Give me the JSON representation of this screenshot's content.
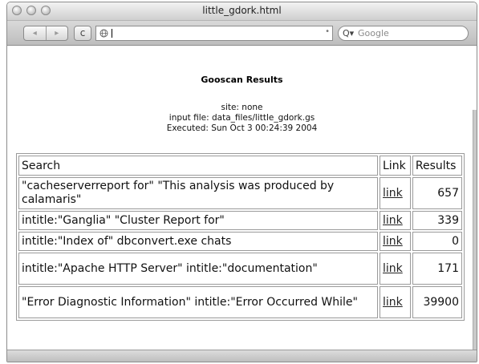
{
  "window": {
    "title": "little_gdork.html"
  },
  "toolbar": {
    "back_icon": "◂",
    "forward_icon": "▸",
    "reload_icon": "c",
    "url_value": "",
    "stop_icon": "•",
    "search_placeholder": "Google",
    "search_icon": "Q▾"
  },
  "page": {
    "title": "Gooscan Results",
    "site_line": "site: none",
    "input_line": "input file: data_files/little_gdork.gs",
    "executed_line": "Executed: Sun Oct 3 00:24:39 2004"
  },
  "table": {
    "headers": [
      "Search",
      "Link",
      "Results"
    ],
    "rows": [
      {
        "search": "\"cacheserverreport for\" \"This analysis was produced by calamaris\"",
        "link": "link",
        "results": "657"
      },
      {
        "search": "intitle:\"Ganglia\" \"Cluster Report for\"",
        "link": "link",
        "results": "339"
      },
      {
        "search": "intitle:\"Index of\" dbconvert.exe chats",
        "link": "link",
        "results": "0"
      },
      {
        "search": "intitle:\"Apache HTTP Server\" intitle:\"documentation\"",
        "link": "link",
        "results": "171"
      },
      {
        "search": "\"Error Diagnostic Information\" intitle:\"Error Occurred While\"",
        "link": "link",
        "results": "39900"
      }
    ]
  }
}
